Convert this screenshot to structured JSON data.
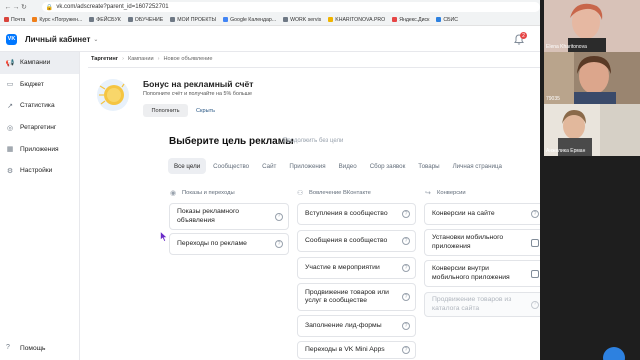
{
  "browser": {
    "url": "vk.com/adscreate?parent_id=1607252701",
    "bookmarks": [
      {
        "label": "Почта",
        "color": "#d9443b"
      },
      {
        "label": "Курс «Погружен...",
        "color": "#ef7f1a"
      },
      {
        "label": "ФЕЙСБУК",
        "color": "#6f7985"
      },
      {
        "label": "ОБУЧЕНИЕ",
        "color": "#6f7985"
      },
      {
        "label": "МОИ ПРОЕКТЫ",
        "color": "#6f7985"
      },
      {
        "label": "Google Календар...",
        "color": "#4285f4"
      },
      {
        "label": "WORK servis",
        "color": "#6f7985"
      },
      {
        "label": "KHARITONOVA.PRO",
        "color": "#f0b400"
      },
      {
        "label": "Яндекс.Диск",
        "color": "#e64646"
      },
      {
        "label": "СБИС",
        "color": "#2d81e0"
      }
    ]
  },
  "header": {
    "logo_text": "VK",
    "title": "Личный кабинет",
    "notification_count": "2"
  },
  "sidebar": {
    "items": [
      {
        "label": "Кампании",
        "icon": "megaphone-icon"
      },
      {
        "label": "Бюджет",
        "icon": "wallet-icon"
      },
      {
        "label": "Статистика",
        "icon": "chart-icon"
      },
      {
        "label": "Ретаргетинг",
        "icon": "target-icon"
      },
      {
        "label": "Приложения",
        "icon": "apps-icon"
      },
      {
        "label": "Настройки",
        "icon": "gear-icon"
      }
    ],
    "help": "Помощь"
  },
  "breadcrumb": [
    "Таргетинг",
    "Кампании",
    "Новое объявление"
  ],
  "bonus": {
    "title": "Бонус на рекламный счёт",
    "description": "Пополните счёт и получайте на 5% больше",
    "topup_label": "Пополнить",
    "hide_label": "Скрыть"
  },
  "goal": {
    "title": "Выберите цель рекламы",
    "skip": "Продолжить без цели",
    "filters": [
      "Все цели",
      "Сообщество",
      "Сайт",
      "Приложения",
      "Видео",
      "Сбор заявок",
      "Товары",
      "Личная страница"
    ]
  },
  "columns": [
    {
      "heading": "Показы и переходы",
      "icon": "eye-icon",
      "cards": [
        "Показы рекламного объявления",
        "Переходы по рекламе"
      ]
    },
    {
      "heading": "Вовлечение ВКонтакте",
      "icon": "people-icon",
      "cards": [
        "Вступления в сообщество",
        "Сообщения в сообщество",
        "Участие в мероприятии",
        "Продвижение товаров или услуг в сообществе",
        "Заполнение лид-формы",
        "Переходы в VK Mini Apps"
      ]
    },
    {
      "heading": "Конверсии",
      "icon": "conversion-icon",
      "cards": [
        "Конверсии на сайте",
        "Установки мобильного приложения",
        "Конверсии внутри мобильного приложения",
        "Продвижение товаров из каталога сайта"
      ]
    }
  ],
  "video": {
    "participants": [
      "Elena Kharitonova",
      "79035",
      "Анжелика Ерман"
    ]
  }
}
